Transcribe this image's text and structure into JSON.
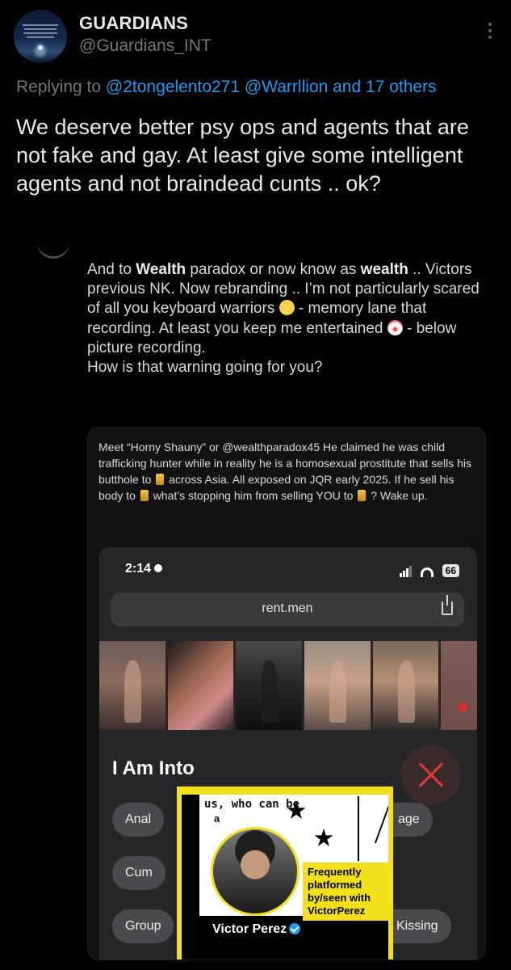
{
  "author": {
    "name": "GUARDIANS",
    "handle": "@Guardians_INT"
  },
  "reply": {
    "prefix": "Replying to",
    "mention1": "@2tongelento271",
    "mention2": "@Warrllion",
    "suffix": "and 17 others"
  },
  "tweet": {
    "text": "We deserve better psy ops and agents that are not fake and gay. At least give some intelligent agents and not braindead cunts .. ok?"
  },
  "quoted": {
    "l1a": "And to ",
    "l1b": "Wealth",
    "l1c": " paradox or now know as ",
    "l1d": "wealth",
    "l1e": " ..",
    "l2": "Victors previous NK. Now rebranding .. I’m not particularly scared of all you keyboard warriors",
    "l3": " - memory lane that recording. At least you keep me entertained ",
    "l4": " - below picture recording.",
    "l5": "How is that warning going for you?"
  },
  "card": {
    "c1": "Meet “Horny Shauny” or @wealthparadox45 He claimed he was  child trafficking hunter while in reality he is a homosexual prostitute that sells his butthole to ",
    "c2": " across Asia. All exposed on JQR early 2025. If he sell his body to ",
    "c3": " what’s stopping him from selling YOU to ",
    "c4": " ? Wake up."
  },
  "phone": {
    "time": "2:14",
    "battery": "66",
    "url": "rent.men",
    "section_title": "I Am Into",
    "chips": [
      "Anal",
      "age",
      "Cum",
      "Group",
      "Kissing"
    ]
  },
  "overlay": {
    "top_text": "us, who can be",
    "top_text2": "a",
    "note": "Frequently platformed by/seen with VictorPerez",
    "name": "Victor Perez"
  }
}
